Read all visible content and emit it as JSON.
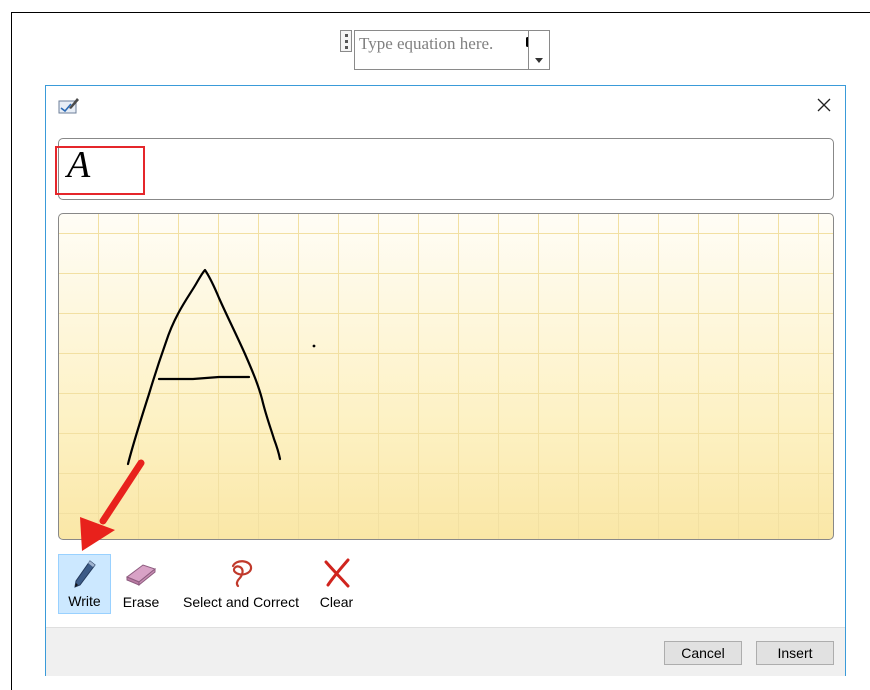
{
  "equation_field": {
    "placeholder": "Type equation here."
  },
  "dialog": {
    "app_icon": "math-input-icon",
    "close_icon": "close-icon",
    "preview_text": "A",
    "highlight_color": "#e5262b",
    "pad_colors": {
      "background": "#fdf2c8",
      "grid": "#f2e0a2",
      "ink": "#000000"
    },
    "tools": [
      {
        "id": "write",
        "label": "Write",
        "icon": "pen-icon",
        "active": true
      },
      {
        "id": "erase",
        "label": "Erase",
        "icon": "eraser-icon",
        "active": false
      },
      {
        "id": "select",
        "label": "Select and Correct",
        "icon": "lasso-icon",
        "active": false
      },
      {
        "id": "clear",
        "label": "Clear",
        "icon": "clear-x-icon",
        "active": false
      }
    ],
    "buttons": {
      "cancel": "Cancel",
      "insert": "Insert"
    },
    "annotation_arrow_color": "#e8211c"
  }
}
